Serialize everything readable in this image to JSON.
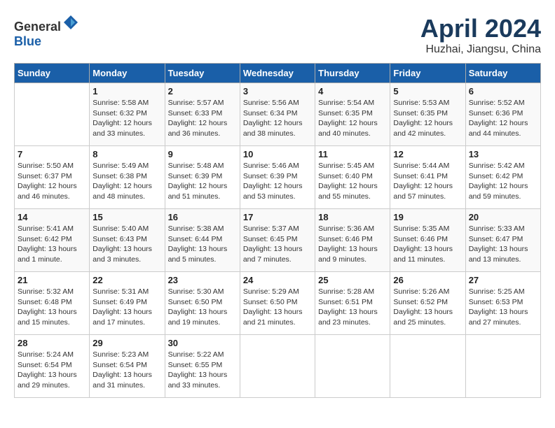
{
  "header": {
    "logo_general": "General",
    "logo_blue": "Blue",
    "title": "April 2024",
    "location": "Huzhai, Jiangsu, China"
  },
  "calendar": {
    "days_of_week": [
      "Sunday",
      "Monday",
      "Tuesday",
      "Wednesday",
      "Thursday",
      "Friday",
      "Saturday"
    ],
    "weeks": [
      [
        {
          "day": "",
          "info": ""
        },
        {
          "day": "1",
          "info": "Sunrise: 5:58 AM\nSunset: 6:32 PM\nDaylight: 12 hours\nand 33 minutes."
        },
        {
          "day": "2",
          "info": "Sunrise: 5:57 AM\nSunset: 6:33 PM\nDaylight: 12 hours\nand 36 minutes."
        },
        {
          "day": "3",
          "info": "Sunrise: 5:56 AM\nSunset: 6:34 PM\nDaylight: 12 hours\nand 38 minutes."
        },
        {
          "day": "4",
          "info": "Sunrise: 5:54 AM\nSunset: 6:35 PM\nDaylight: 12 hours\nand 40 minutes."
        },
        {
          "day": "5",
          "info": "Sunrise: 5:53 AM\nSunset: 6:35 PM\nDaylight: 12 hours\nand 42 minutes."
        },
        {
          "day": "6",
          "info": "Sunrise: 5:52 AM\nSunset: 6:36 PM\nDaylight: 12 hours\nand 44 minutes."
        }
      ],
      [
        {
          "day": "7",
          "info": "Sunrise: 5:50 AM\nSunset: 6:37 PM\nDaylight: 12 hours\nand 46 minutes."
        },
        {
          "day": "8",
          "info": "Sunrise: 5:49 AM\nSunset: 6:38 PM\nDaylight: 12 hours\nand 48 minutes."
        },
        {
          "day": "9",
          "info": "Sunrise: 5:48 AM\nSunset: 6:39 PM\nDaylight: 12 hours\nand 51 minutes."
        },
        {
          "day": "10",
          "info": "Sunrise: 5:46 AM\nSunset: 6:39 PM\nDaylight: 12 hours\nand 53 minutes."
        },
        {
          "day": "11",
          "info": "Sunrise: 5:45 AM\nSunset: 6:40 PM\nDaylight: 12 hours\nand 55 minutes."
        },
        {
          "day": "12",
          "info": "Sunrise: 5:44 AM\nSunset: 6:41 PM\nDaylight: 12 hours\nand 57 minutes."
        },
        {
          "day": "13",
          "info": "Sunrise: 5:42 AM\nSunset: 6:42 PM\nDaylight: 12 hours\nand 59 minutes."
        }
      ],
      [
        {
          "day": "14",
          "info": "Sunrise: 5:41 AM\nSunset: 6:42 PM\nDaylight: 13 hours\nand 1 minute."
        },
        {
          "day": "15",
          "info": "Sunrise: 5:40 AM\nSunset: 6:43 PM\nDaylight: 13 hours\nand 3 minutes."
        },
        {
          "day": "16",
          "info": "Sunrise: 5:38 AM\nSunset: 6:44 PM\nDaylight: 13 hours\nand 5 minutes."
        },
        {
          "day": "17",
          "info": "Sunrise: 5:37 AM\nSunset: 6:45 PM\nDaylight: 13 hours\nand 7 minutes."
        },
        {
          "day": "18",
          "info": "Sunrise: 5:36 AM\nSunset: 6:46 PM\nDaylight: 13 hours\nand 9 minutes."
        },
        {
          "day": "19",
          "info": "Sunrise: 5:35 AM\nSunset: 6:46 PM\nDaylight: 13 hours\nand 11 minutes."
        },
        {
          "day": "20",
          "info": "Sunrise: 5:33 AM\nSunset: 6:47 PM\nDaylight: 13 hours\nand 13 minutes."
        }
      ],
      [
        {
          "day": "21",
          "info": "Sunrise: 5:32 AM\nSunset: 6:48 PM\nDaylight: 13 hours\nand 15 minutes."
        },
        {
          "day": "22",
          "info": "Sunrise: 5:31 AM\nSunset: 6:49 PM\nDaylight: 13 hours\nand 17 minutes."
        },
        {
          "day": "23",
          "info": "Sunrise: 5:30 AM\nSunset: 6:50 PM\nDaylight: 13 hours\nand 19 minutes."
        },
        {
          "day": "24",
          "info": "Sunrise: 5:29 AM\nSunset: 6:50 PM\nDaylight: 13 hours\nand 21 minutes."
        },
        {
          "day": "25",
          "info": "Sunrise: 5:28 AM\nSunset: 6:51 PM\nDaylight: 13 hours\nand 23 minutes."
        },
        {
          "day": "26",
          "info": "Sunrise: 5:26 AM\nSunset: 6:52 PM\nDaylight: 13 hours\nand 25 minutes."
        },
        {
          "day": "27",
          "info": "Sunrise: 5:25 AM\nSunset: 6:53 PM\nDaylight: 13 hours\nand 27 minutes."
        }
      ],
      [
        {
          "day": "28",
          "info": "Sunrise: 5:24 AM\nSunset: 6:54 PM\nDaylight: 13 hours\nand 29 minutes."
        },
        {
          "day": "29",
          "info": "Sunrise: 5:23 AM\nSunset: 6:54 PM\nDaylight: 13 hours\nand 31 minutes."
        },
        {
          "day": "30",
          "info": "Sunrise: 5:22 AM\nSunset: 6:55 PM\nDaylight: 13 hours\nand 33 minutes."
        },
        {
          "day": "",
          "info": ""
        },
        {
          "day": "",
          "info": ""
        },
        {
          "day": "",
          "info": ""
        },
        {
          "day": "",
          "info": ""
        }
      ]
    ]
  }
}
